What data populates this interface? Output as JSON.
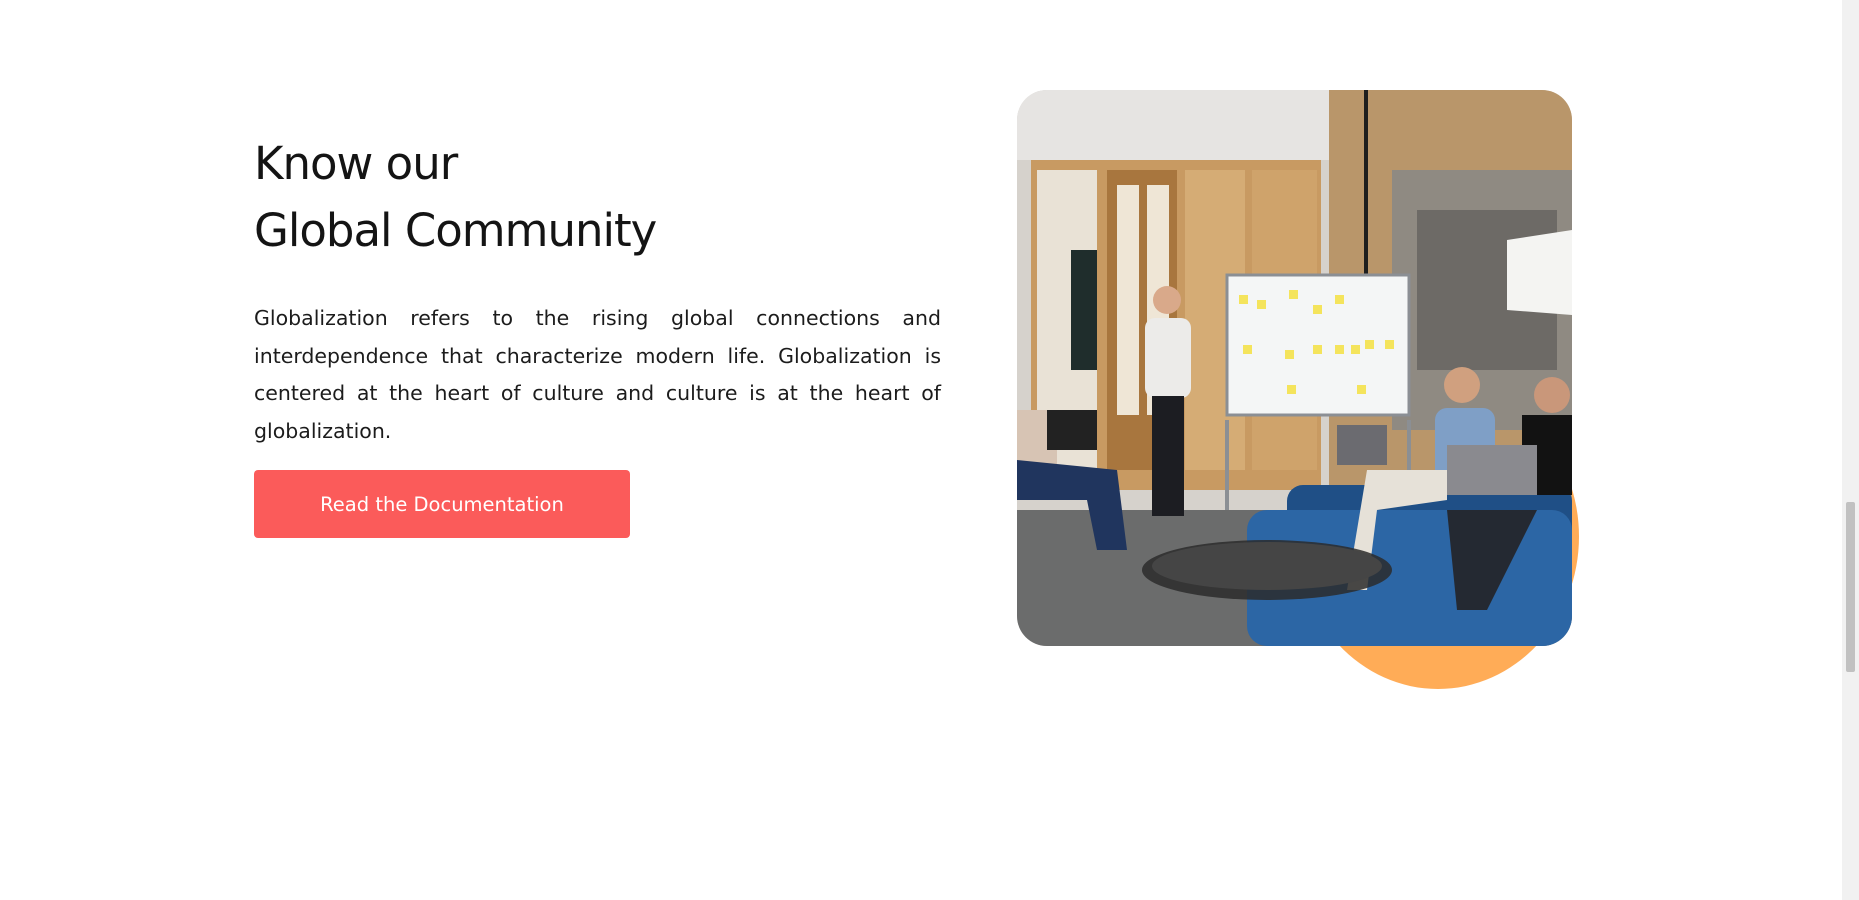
{
  "section": {
    "title_line1": "Know our",
    "title_line2": "Global Community",
    "description": "Globalization refers to the rising global connections and interdependence that characterize modern life. Globalization is centered at the heart of culture and culture is at the heart of globalization.",
    "cta_label": "Read the Documentation"
  },
  "colors": {
    "cta_background": "#fb5b5a",
    "accent_circle": "#ffac57",
    "title_text": "#141414"
  },
  "icons": {
    "photo": "team-meeting-photo"
  }
}
